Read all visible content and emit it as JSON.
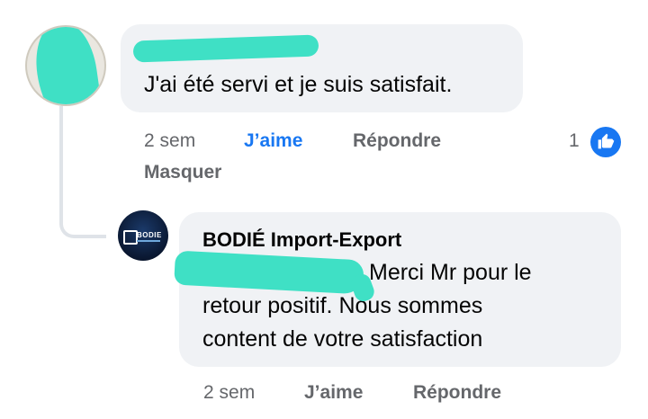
{
  "comment": {
    "text": "J'ai été servi et je suis satisfait.",
    "actions": {
      "time": "2 sem",
      "like": "J’aime",
      "reply": "Répondre",
      "hide": "Masquer"
    },
    "reaction_count": "1",
    "like_state": "liked",
    "like_color": "#1877f2"
  },
  "reply": {
    "author": "BODIÉ Import-Export",
    "lines": [
      "Merci Mr pour le",
      "retour positif. Nous sommes",
      "content de votre satisfaction"
    ],
    "avatar_logo_text": "BODIE",
    "actions": {
      "time": "2 sem",
      "like": "J’aime",
      "reply": "Répondre"
    }
  },
  "icons": {
    "like_badge": "thumbs-up-icon"
  },
  "colors": {
    "bubble_bg": "#f0f2f5",
    "muted_text": "#65676b",
    "text": "#050505",
    "redaction": "#3fe0c5"
  }
}
